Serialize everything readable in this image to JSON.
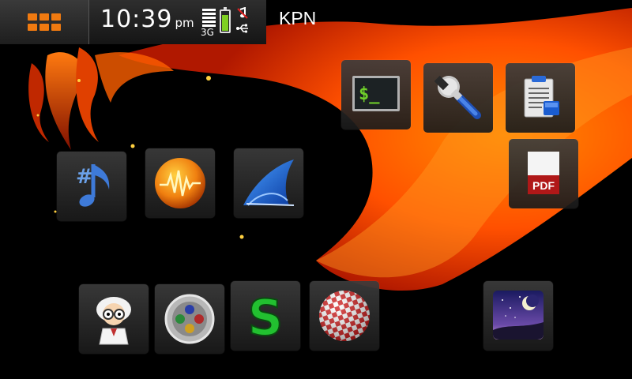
{
  "statusbar": {
    "menu_icon": "app-grid-icon",
    "time": "10:39",
    "ampm": "pm",
    "network_type": "3G",
    "signal_bars": 5,
    "battery_level": 0.85,
    "battery_color": "#7fd022",
    "indicators": [
      "music-muted-icon",
      "usb-icon"
    ],
    "operator": "KPN"
  },
  "desktop": {
    "apps": [
      {
        "icon": "terminal-icon",
        "label": "$_"
      },
      {
        "icon": "wrench-settings-icon"
      },
      {
        "icon": "clipboard-notes-icon"
      },
      {
        "icon": "pdf-document-icon",
        "label": "PDF"
      },
      {
        "icon": "music-sharp-note-icon",
        "label": "#"
      },
      {
        "icon": "audio-waveform-orb-icon"
      },
      {
        "icon": "wireshark-fin-icon"
      },
      {
        "icon": "mad-scientist-icon"
      },
      {
        "icon": "gamepad-buttons-icon"
      },
      {
        "icon": "green-s-icon",
        "label": "S"
      },
      {
        "icon": "checkered-ball-icon"
      },
      {
        "icon": "night-sky-moon-icon"
      }
    ]
  },
  "colors": {
    "accent_orange": "#f07a10",
    "wallpaper_flame": "#ff5a00"
  }
}
